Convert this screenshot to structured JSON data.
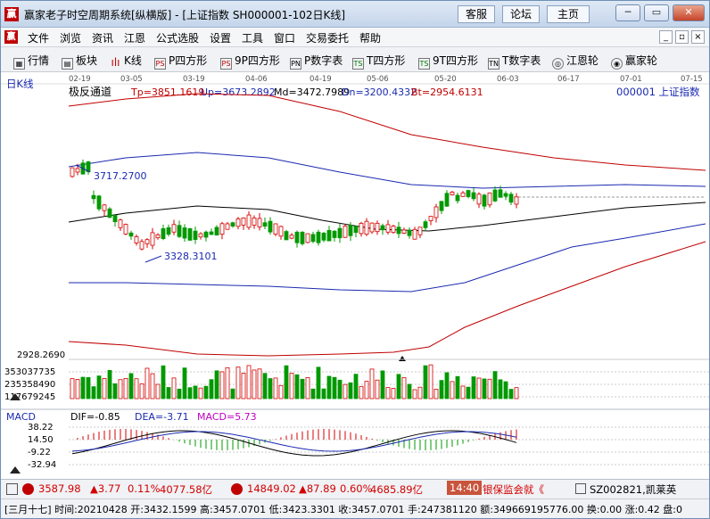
{
  "window": {
    "title": "赢家老子时空周期系统[纵横版] - [上证指数  SH000001-102日K线]",
    "links": [
      "客服",
      "论坛",
      "主页"
    ],
    "controls": {
      "minimize": "─",
      "maximize": "▭",
      "close": "✕"
    }
  },
  "menubar": {
    "items": [
      "文件",
      "浏览",
      "资讯",
      "江恩",
      "公式选股",
      "设置",
      "工具",
      "窗口",
      "交易委托",
      "帮助"
    ],
    "mdi": [
      "_",
      "▫",
      "×"
    ]
  },
  "toolbar": {
    "items": [
      {
        "label": "行情",
        "icon": "grid-icon"
      },
      {
        "label": "板块",
        "icon": "blocks-icon"
      },
      {
        "label": "K线",
        "icon": "candlestick-icon"
      },
      {
        "label": "P四方形",
        "icon": "PS"
      },
      {
        "label": "9P四方形",
        "icon": "PS"
      },
      {
        "label": "P数字表",
        "icon": "PN"
      },
      {
        "label": "T四方形",
        "icon": "TS"
      },
      {
        "label": "9T四方形",
        "icon": "TS"
      },
      {
        "label": "T数字表",
        "icon": "TN"
      },
      {
        "label": "江恩轮",
        "icon": "gann-wheel-icon"
      },
      {
        "label": "赢家轮",
        "icon": "winner-wheel-icon"
      }
    ]
  },
  "chart": {
    "period_label": "日K线",
    "dates": [
      "02-19",
      "03-05",
      "03-19",
      "04-06",
      "04-19",
      "05-06",
      "05-20",
      "06-03",
      "06-17",
      "07-01",
      "07-15"
    ],
    "indicator_name": "极反通道",
    "indicators": {
      "tp": "Tp=3851.1619",
      "up": "Up=3673.2892",
      "md": "Md=3472.7989",
      "dn": "Dn=3200.4332",
      "bt": "Bt=2954.6131"
    },
    "code_label": "000001  上证指数",
    "high_label": "3717.2700",
    "low_label": "3328.3101",
    "bottom_price_label": "2928.2690",
    "volume_labels": [
      "353037735",
      "235358490",
      "117679245"
    ],
    "macd": {
      "name": "MACD",
      "dif": "DIF=-0.85",
      "dea": "DEA=-3.71",
      "macd": "MACD=5.73",
      "axis": [
        "38.22",
        "14.50",
        "-9.22",
        "-32.94"
      ]
    },
    "colors": {
      "up": "#d40000",
      "down": "#009900",
      "md_line": "#000000",
      "up_band": "#1a2ab0",
      "outer_band": "#c00000"
    }
  },
  "status1": {
    "sh_index": "3587.98",
    "sh_change": "▲3.77",
    "sh_pct": "0.11%",
    "sh_amount": "4077.58亿",
    "sz_index": "14849.02",
    "sz_change": "▲87.89",
    "sz_pct": "0.60%",
    "sz_amount": "4685.89亿",
    "time": "14:40",
    "news": "银保监会就《",
    "stock": "SZ002821,凯莱英"
  },
  "status2": {
    "text": "[三月十七] 时间:20210428 开:3432.1599 高:3457.0701 低:3423.3301 收:3457.0701 手:247381120 额:349669195776.00 换:0.00 涨:0.42 盘:0"
  }
}
